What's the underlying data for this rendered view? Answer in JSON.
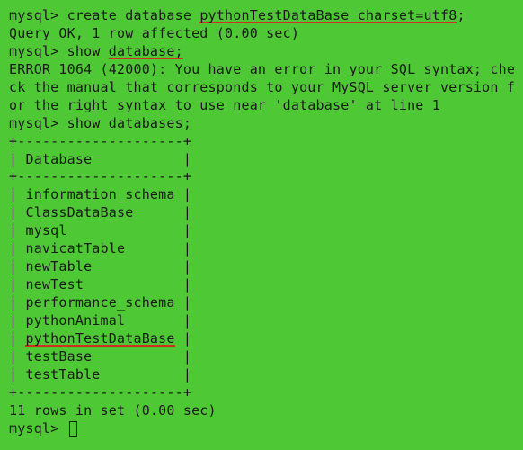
{
  "prompt": "mysql>",
  "cmd1_pre": " create database ",
  "cmd1_ul": "pythonTestDataBase charset=utf8",
  "cmd1_post": ";",
  "resp1": "Query OK, 1 row affected (0.00 sec)",
  "blank": "",
  "cmd2_pre": " show ",
  "cmd2_ul": "database;",
  "err_l1": "ERROR 1064 (42000): You have an error in your SQL syntax; che",
  "err_l2": "ck the manual that corresponds to your MySQL server version f",
  "err_l3": "or the right syntax to use near 'database' at line 1",
  "cmd3": " show databases;",
  "tbl_sep": "+--------------------+",
  "tbl_hdr": "| Database           |",
  "rows": {
    "r0": "| information_schema |",
    "r1": "| ClassDataBase      |",
    "r2": "| mysql              |",
    "r3": "| navicatTable       |",
    "r4": "| newTable           |",
    "r5": "| newTest            |",
    "r6": "| performance_schema |",
    "r7": "| pythonAnimal       |",
    "r8_pre": "| ",
    "r8_ul": "pythonTestDataBase",
    "r8_post": " |",
    "r9": "| testBase           |",
    "r10": "| testTable          |"
  },
  "summary": "11 rows in set (0.00 sec)",
  "final_prompt_sp": " "
}
